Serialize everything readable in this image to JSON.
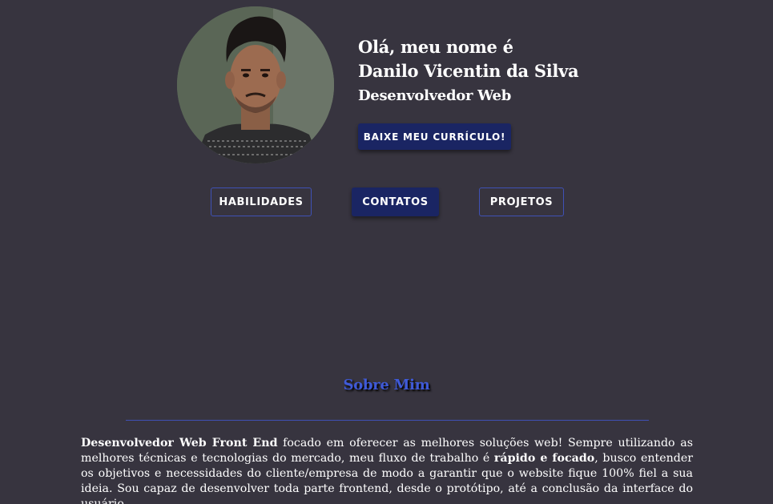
{
  "profile": {
    "greeting": "Olá, meu nome é",
    "name": "Danilo Vicentin da Silva",
    "role": "Desenvolvedor Web",
    "cv_button": "BAIXE MEU CURRÍCULO!"
  },
  "nav": {
    "items": [
      {
        "label": "HABILIDADES"
      },
      {
        "label": "CONTATOS"
      },
      {
        "label": "PROJETOS"
      }
    ]
  },
  "about": {
    "title": "Sobre Mim",
    "bold_1": "Desenvolvedor Web Front End",
    "text_1": " focado em oferecer as melhores soluções web! Sempre utilizando as melhores técnicas e tecnologias do mercado, meu fluxo de trabalho é ",
    "bold_2": "rápido e focado",
    "text_2": ", busco entender os objetivos e necessidades do cliente/empresa de modo a garantir que o website fique 100% fiel a sua ideia. Sou capaz de desenvolver toda parte frontend, desde o protótipo, até a conclusão da interface do usuário."
  },
  "colors": {
    "background": "#37343f",
    "primary_dark": "#1a2563",
    "accent_blue": "#3f51b5",
    "title_blue": "#3f5ad8"
  }
}
